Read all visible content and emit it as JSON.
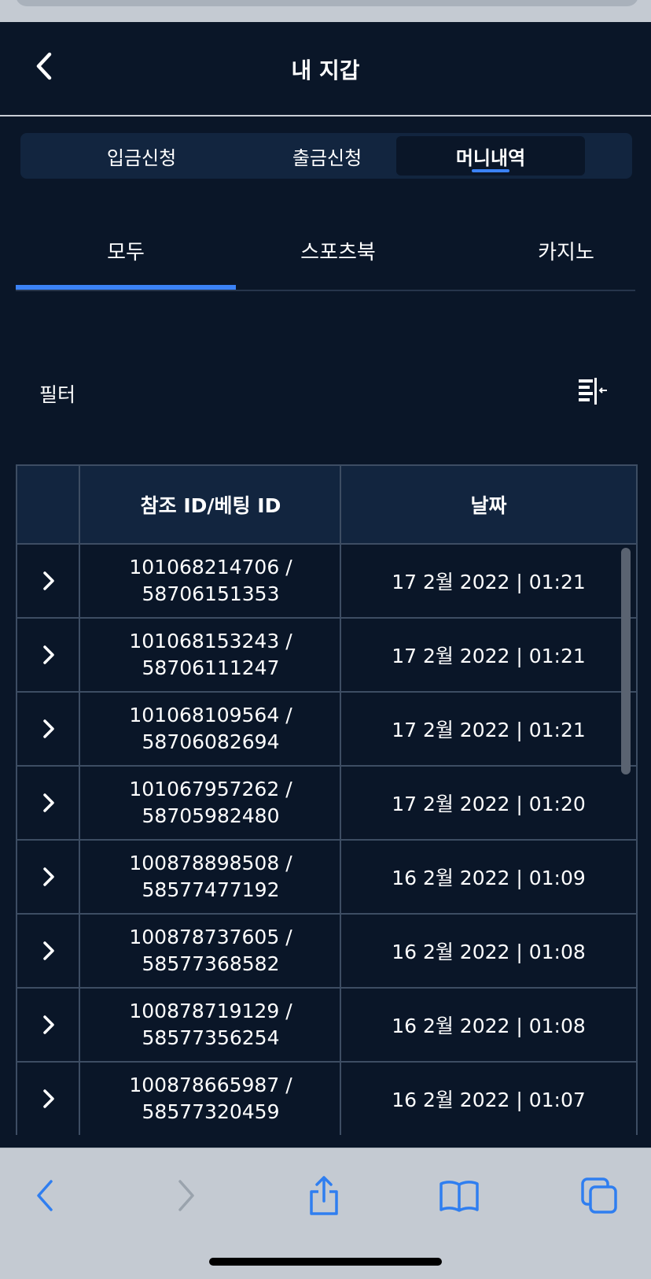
{
  "header": {
    "title": "내 지갑",
    "back_icon": "chevron-left-icon"
  },
  "segments": [
    {
      "label": "입금신청",
      "active": false
    },
    {
      "label": "출금신청",
      "active": false
    },
    {
      "label": "머니내역",
      "active": true
    }
  ],
  "tabs": [
    {
      "label": "모두",
      "active": true
    },
    {
      "label": "스포츠북",
      "active": false
    },
    {
      "label": "카지노",
      "active": false
    }
  ],
  "filter": {
    "label": "필터",
    "icon": "filter-collapse-icon"
  },
  "table": {
    "headers": [
      "",
      "참조 ID/베팅 ID",
      "날짜"
    ],
    "rows": [
      {
        "ref": "101068214706 /",
        "bet": "58706151353",
        "date": "17 2월 2022 | 01:21"
      },
      {
        "ref": "101068153243 /",
        "bet": "58706111247",
        "date": "17 2월 2022 | 01:21"
      },
      {
        "ref": "101068109564 /",
        "bet": "58706082694",
        "date": "17 2월 2022 | 01:21"
      },
      {
        "ref": "101067957262 /",
        "bet": "58705982480",
        "date": "17 2월 2022 | 01:20"
      },
      {
        "ref": "100878898508 /",
        "bet": "58577477192",
        "date": "16 2월 2022 | 01:09"
      },
      {
        "ref": "100878737605 /",
        "bet": "58577368582",
        "date": "16 2월 2022 | 01:08"
      },
      {
        "ref": "100878719129 /",
        "bet": "58577356254",
        "date": "16 2월 2022 | 01:08"
      },
      {
        "ref": "100878665987 /",
        "bet": "58577320459",
        "date": "16 2월 2022 | 01:07"
      }
    ]
  },
  "colors": {
    "background": "#0a1628",
    "accent": "#3b82f6",
    "header_row": "#12253f",
    "toolbar": "#c4cad2"
  },
  "browser_toolbar": [
    "back-icon",
    "forward-icon",
    "share-icon",
    "bookmarks-icon",
    "tabs-icon"
  ]
}
